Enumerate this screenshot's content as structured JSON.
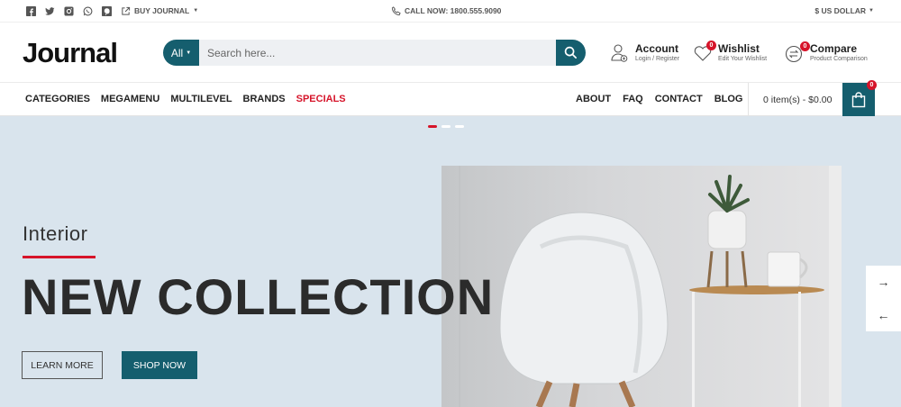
{
  "topbar": {
    "social_icons": [
      "facebook-icon",
      "twitter-icon",
      "instagram-icon",
      "whatsapp-icon",
      "pinterest-icon"
    ],
    "buy_label": "BUY JOURNAL",
    "call_label": "CALL NOW: 1800.555.9090",
    "currency_label": "$ US DOLLAR"
  },
  "header": {
    "logo": "Journal",
    "search": {
      "category": "All",
      "placeholder": "Search here..."
    },
    "account": {
      "title": "Account",
      "sub": "Login / Register"
    },
    "wishlist": {
      "title": "Wishlist",
      "sub": "Edit Your Wishlist",
      "count": "0"
    },
    "compare": {
      "title": "Compare",
      "sub": "Product Comparison",
      "count": "0"
    }
  },
  "nav": {
    "left": [
      "CATEGORIES",
      "MEGAMENU",
      "MULTILEVEL",
      "BRANDS"
    ],
    "specials": "SPECIALS",
    "right": [
      "ABOUT",
      "FAQ",
      "CONTACT",
      "BLOG"
    ],
    "cart_text": "0 item(s) - $0.00",
    "cart_count": "0"
  },
  "hero": {
    "subtitle": "Interior",
    "title": "NEW COLLECTION",
    "learn_more": "LEARN MORE",
    "shop_now": "SHOP NOW",
    "next_arrow": "→",
    "prev_arrow": "←"
  },
  "colors": {
    "brand": "#155e6e",
    "accent": "#d6142a",
    "hero_bg": "#d9e4ed"
  }
}
